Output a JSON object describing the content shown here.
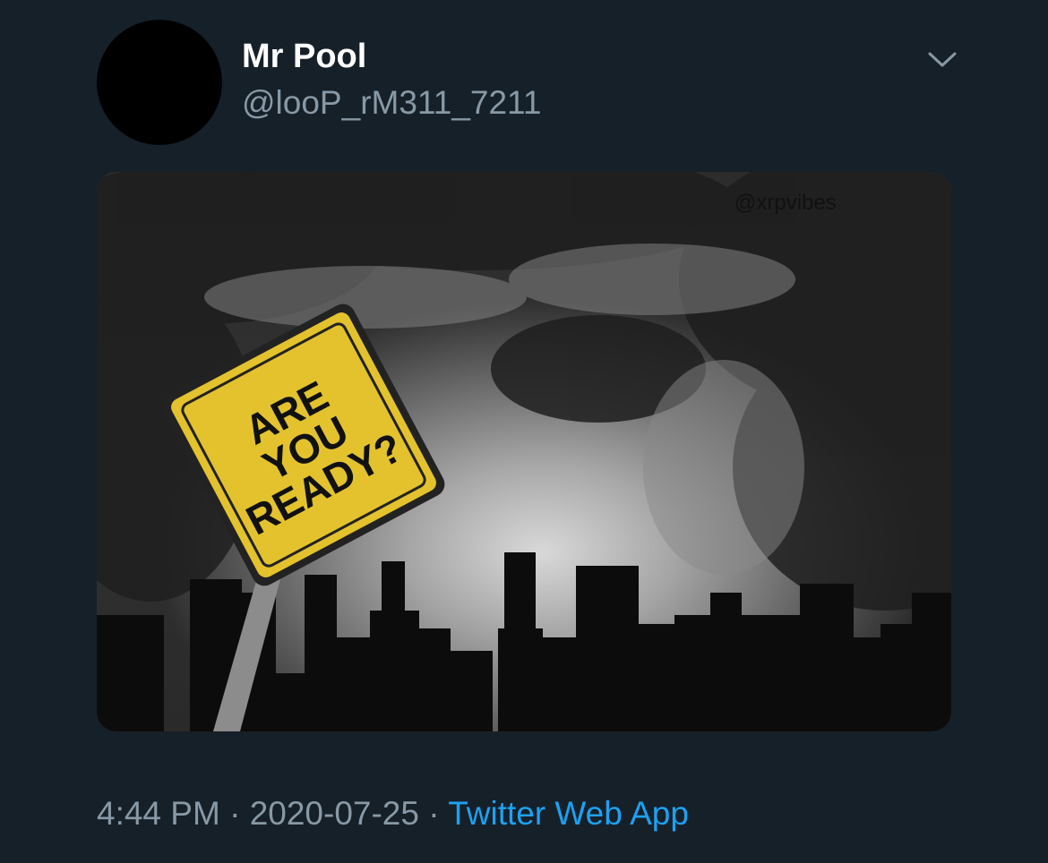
{
  "tweet": {
    "display_name": "Mr Pool",
    "handle": "@looP_rM311_7211",
    "media": {
      "watermark": "@xrpvibes",
      "sign_text": [
        "ARE",
        "YOU",
        "READY?"
      ]
    },
    "time": "4:44 PM",
    "separator": "·",
    "date": "2020-07-25",
    "source": "Twitter Web App"
  },
  "colors": {
    "background": "#162029",
    "secondary_text": "#8899a6",
    "link": "#1da1f2",
    "sign": "#e3c22d"
  },
  "icons": {
    "menu": "chevron-down-icon"
  }
}
